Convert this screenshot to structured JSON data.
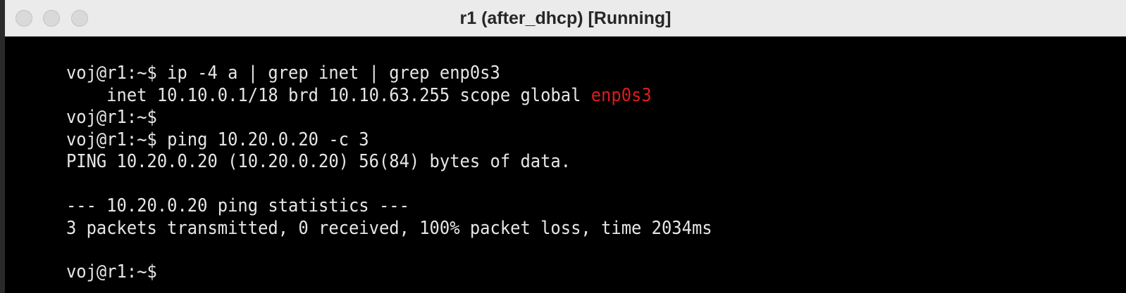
{
  "window": {
    "title": "r1 (after_dhcp) [Running]"
  },
  "terminal": {
    "lines": [
      {
        "text": "voj@r1:~$ ip -4 a | grep inet | grep enp0s3"
      },
      {
        "text": "    inet 10.10.0.1/18 brd 10.10.63.255 scope global ",
        "highlight": "enp0s3"
      },
      {
        "text": "voj@r1:~$"
      },
      {
        "text": "voj@r1:~$ ping 10.20.0.20 -c 3"
      },
      {
        "text": "PING 10.20.0.20 (10.20.0.20) 56(84) bytes of data."
      },
      {
        "text": ""
      },
      {
        "text": "--- 10.20.0.20 ping statistics ---"
      },
      {
        "text": "3 packets transmitted, 0 received, 100% packet loss, time 2034ms"
      },
      {
        "text": ""
      },
      {
        "text": "voj@r1:~$"
      }
    ]
  },
  "colors": {
    "foreground": "#e6e6e6",
    "background": "#000000",
    "interface_highlight": "#e01b1b"
  }
}
